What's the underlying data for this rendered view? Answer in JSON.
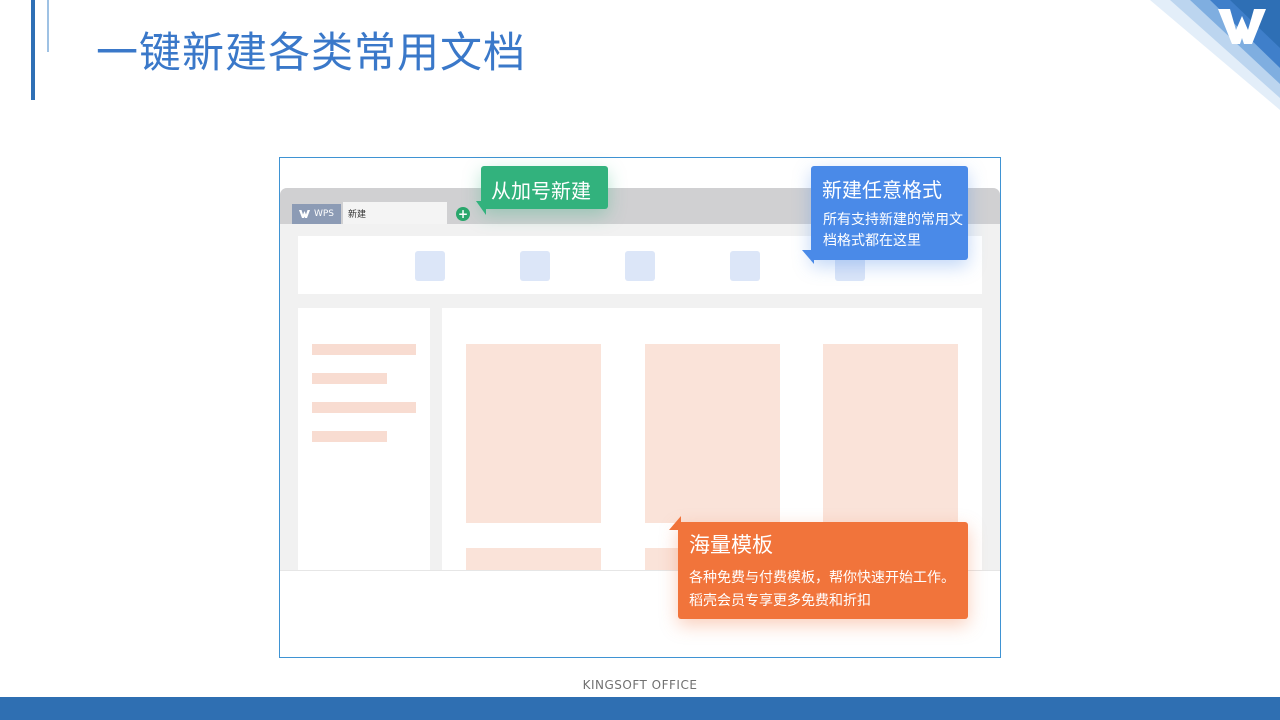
{
  "slide": {
    "title": "一键新建各类常用文档",
    "footer": "KINGSOFT  OFFICE"
  },
  "app": {
    "wps_tab_label": "WPS",
    "doc_tab_label": "新建",
    "plus_symbol": "+"
  },
  "callouts": {
    "plus": {
      "title": "从加号新建"
    },
    "formats": {
      "title": "新建任意格式",
      "desc": "所有支持新建的常用文档格式都在这里"
    },
    "templates": {
      "title": "海量模板",
      "desc": "各种免费与付费模板，帮你快速开始工作。稻壳会员专享更多免费和折扣"
    }
  },
  "colors": {
    "accent": "#2e6fb5",
    "title": "#3a78c9",
    "green_callout": "#32b27d",
    "blue_callout": "#4a8ae8",
    "orange_callout": "#f1743b",
    "template_placeholder": "#fae3d9"
  },
  "icons": {
    "corner_logo": "wps-logo-icon",
    "plus_button": "plus-circle-icon"
  }
}
